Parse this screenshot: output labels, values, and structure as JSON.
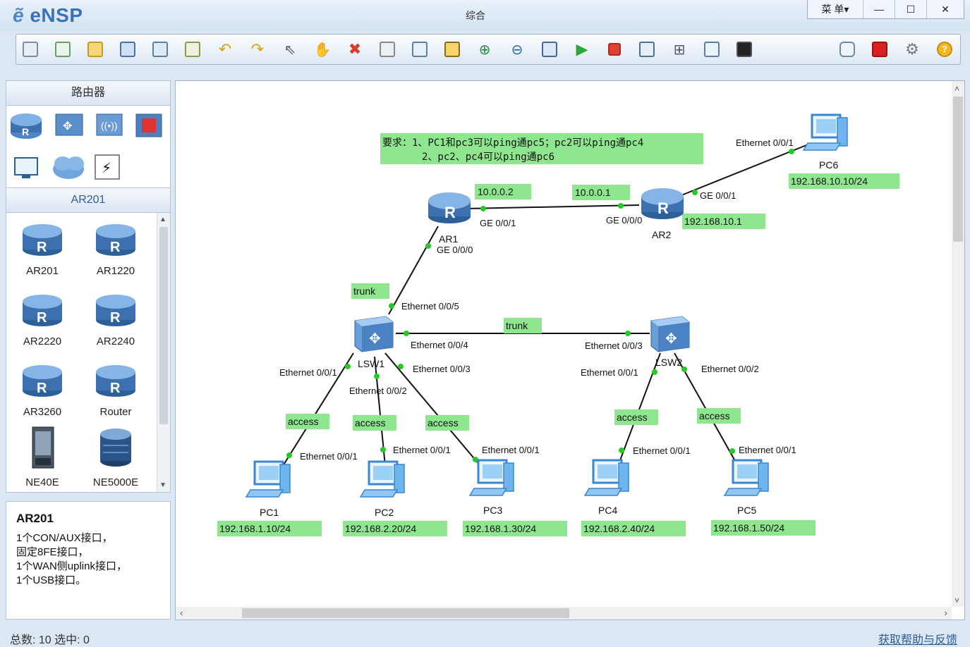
{
  "app": {
    "name": "eNSP",
    "window_title": "综合",
    "menu_label": "菜 单▾"
  },
  "toolbar_icons": [
    "new-topology-icon",
    "new-lab-icon",
    "open-icon",
    "save-icon",
    "save-as-icon",
    "print-icon",
    "undo-icon",
    "redo-icon",
    "select-icon",
    "pan-icon",
    "delete-icon",
    "delete-link-icon",
    "text-note-icon",
    "rectangle-icon",
    "zoom-in-icon",
    "zoom-out-icon",
    "fit-view-icon",
    "start-icon",
    "stop-icon",
    "capture-icon",
    "topology-icon",
    "grid-icon",
    "terminal-icon",
    "chat-icon",
    "huawei-icon",
    "settings-icon",
    "help-icon"
  ],
  "sidebar": {
    "category_title": "路由器",
    "series_title": "AR201",
    "devices": [
      {
        "label": "AR201"
      },
      {
        "label": "AR1220"
      },
      {
        "label": "AR2220"
      },
      {
        "label": "AR2240"
      },
      {
        "label": "AR3260"
      },
      {
        "label": "Router"
      },
      {
        "label": "NE40E"
      },
      {
        "label": "NE5000E"
      }
    ],
    "description": {
      "title": "AR201",
      "lines": [
        "1个CON/AUX接口，",
        "固定8FE接口，",
        "1个WAN侧uplink接口，",
        "1个USB接口。"
      ]
    }
  },
  "topology": {
    "note_line1": "要求：1、PC1和pc3可以ping通pc5；pc2可以ping通pc4",
    "note_line2": "2、pc2、pc4可以ping通pc6",
    "nodes": {
      "AR1": "AR1",
      "AR2": "AR2",
      "LSW1": "LSW1",
      "LSW2": "LSW2",
      "PC1": "PC1",
      "PC2": "PC2",
      "PC3": "PC3",
      "PC4": "PC4",
      "PC5": "PC5",
      "PC6": "PC6"
    },
    "ips": {
      "ar1": "10.0.0.2",
      "ar2": "10.0.0.1",
      "ar2_lan": "192.168.10.1",
      "pc1": "192.168.1.10/24",
      "pc2": "192.168.2.20/24",
      "pc3": "192.168.1.30/24",
      "pc4": "192.168.2.40/24",
      "pc5": "192.168.1.50/24",
      "pc6": "192.168.10.10/24"
    },
    "links": {
      "trunk": "trunk",
      "access": "access",
      "ar1_ge001": "GE 0/0/1",
      "ar1_ge000": "GE 0/0/0",
      "ar2_ge000": "GE 0/0/0",
      "ar2_ge001": "GE 0/0/1",
      "eth005": "Ethernet 0/0/5",
      "eth004": "Ethernet 0/0/4",
      "eth003": "Ethernet 0/0/3",
      "eth002": "Ethernet 0/0/2",
      "eth001": "Ethernet 0/0/1"
    }
  },
  "status": {
    "left": "总数: 10  选中: 0",
    "right": "获取帮助与反馈"
  }
}
